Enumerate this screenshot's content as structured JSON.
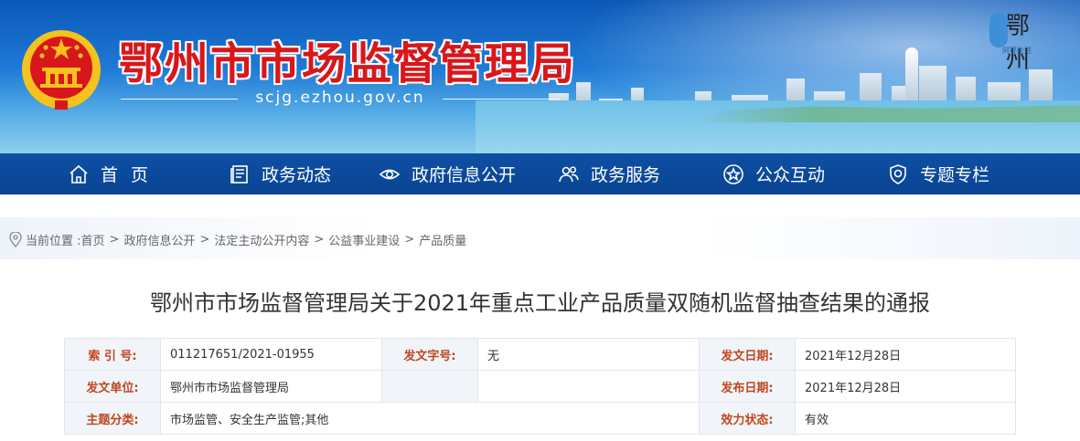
{
  "header": {
    "site_title": "鄂州市市场监督管理局",
    "site_url": "scjg.ezhou.gov.cn",
    "corner_logo_text": "鄂州",
    "corner_logo_sub": "阿鄂生活"
  },
  "nav": {
    "items": [
      {
        "label": "首页",
        "icon": "home-icon"
      },
      {
        "label": "政务动态",
        "icon": "news-icon"
      },
      {
        "label": "政府信息公开",
        "icon": "eye-icon"
      },
      {
        "label": "政务服务",
        "icon": "people-icon"
      },
      {
        "label": "公众互动",
        "icon": "star-icon"
      },
      {
        "label": "专题专栏",
        "icon": "shield-icon"
      }
    ]
  },
  "breadcrumb": {
    "prefix": "当前位置 :",
    "items": [
      "首页",
      "政府信息公开",
      "法定主动公开内容",
      "公益事业建设",
      "产品质量"
    ],
    "separator": ">"
  },
  "article": {
    "title": "鄂州市市场监督管理局关于2021年重点工业产品质量双随机监督抽查结果的通报"
  },
  "meta": {
    "index_label": "索 引 号:",
    "index_value": "011217651/2021-01955",
    "doc_no_label": "发文字号:",
    "doc_no_value": "无",
    "issue_date_label": "发文日期:",
    "issue_date_value": "2021年12月28日",
    "issuer_label": "发文单位:",
    "issuer_value": "鄂州市市场监督管理局",
    "publish_date_label": "发布日期:",
    "publish_date_value": "2021年12月28日",
    "topic_label": "主题分类:",
    "topic_value": "市场监管、安全生产监管;其他",
    "status_label": "效力状态:",
    "status_value": "有效"
  },
  "colors": {
    "nav_bg": "#0a4493",
    "title_red": "#d8171b",
    "meta_key": "#c0461e"
  }
}
